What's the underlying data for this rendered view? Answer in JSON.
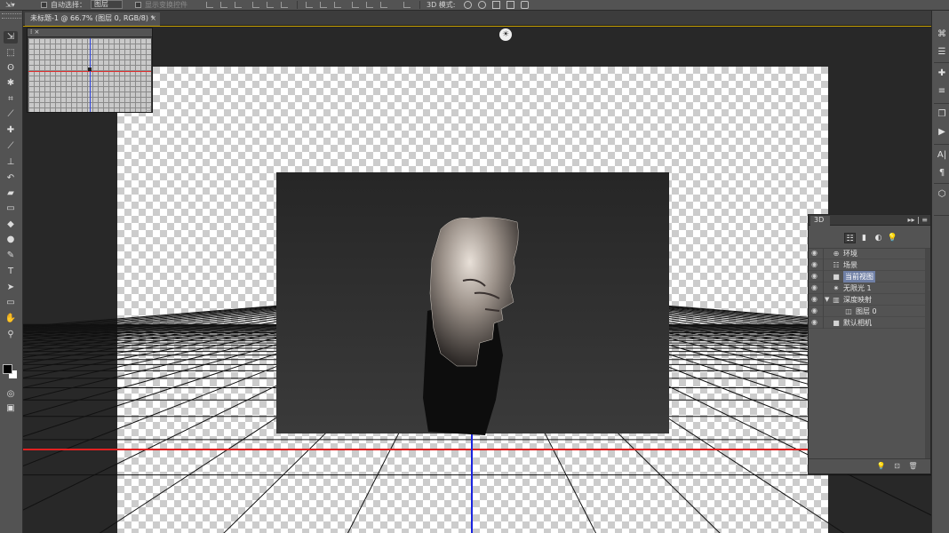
{
  "options_bar": {
    "auto_select_label": "自动选择：",
    "auto_select_value": "图层",
    "show_transform_label": "显示变换控件",
    "mode_3d_label": "3D 模式:"
  },
  "document": {
    "tab_title": "未标题-1 @ 66.7% (图层 0, RGB/8) *",
    "close_glyph": "×"
  },
  "toolbox": {
    "tools": [
      {
        "icon": "move-tool-icon",
        "glyph": "⇲"
      },
      {
        "icon": "marquee-tool-icon",
        "glyph": "⬚"
      },
      {
        "icon": "lasso-tool-icon",
        "glyph": "ʘ"
      },
      {
        "icon": "magic-wand-tool-icon",
        "glyph": "✱"
      },
      {
        "icon": "crop-tool-icon",
        "glyph": "⌗"
      },
      {
        "icon": "eyedropper-tool-icon",
        "glyph": "⟋"
      },
      {
        "icon": "healing-brush-tool-icon",
        "glyph": "✚"
      },
      {
        "icon": "brush-tool-icon",
        "glyph": "⟋"
      },
      {
        "icon": "clone-stamp-tool-icon",
        "glyph": "⊥"
      },
      {
        "icon": "history-brush-tool-icon",
        "glyph": "↶"
      },
      {
        "icon": "eraser-tool-icon",
        "glyph": "▰"
      },
      {
        "icon": "gradient-tool-icon",
        "glyph": "▭"
      },
      {
        "icon": "blur-tool-icon",
        "glyph": "◆"
      },
      {
        "icon": "dodge-tool-icon",
        "glyph": "●"
      },
      {
        "icon": "pen-tool-icon",
        "glyph": "✎"
      },
      {
        "icon": "type-tool-icon",
        "glyph": "T"
      },
      {
        "icon": "path-selection-tool-icon",
        "glyph": "➤"
      },
      {
        "icon": "rectangle-tool-icon",
        "glyph": "▭"
      },
      {
        "icon": "hand-tool-icon",
        "glyph": "✋"
      },
      {
        "icon": "zoom-tool-icon",
        "glyph": "⚲"
      }
    ],
    "foreground_color": "#000000",
    "background_color": "#ffffff"
  },
  "navigator": {
    "header_glyphs": "⁞ ×"
  },
  "view_widget_glyph": "☀",
  "panel_3d": {
    "tab_label": "3D",
    "menu_glyph": "▸▸ | ≡",
    "filter_icons": [
      "scene-filter-icon",
      "mesh-filter-icon",
      "material-filter-icon",
      "light-filter-icon"
    ],
    "filter_glyphs": [
      "☷",
      "▮",
      "◐",
      "💡"
    ],
    "tree": [
      {
        "label": "环境",
        "icon": "environment-icon",
        "glyph": "⊕",
        "indent": 0,
        "expanded": null,
        "selected": false
      },
      {
        "label": "场景",
        "icon": "scene-icon",
        "glyph": "☷",
        "indent": 0,
        "expanded": null,
        "selected": false
      },
      {
        "label": "当前视图",
        "icon": "camera-icon",
        "glyph": "■",
        "indent": 0,
        "expanded": null,
        "selected": true
      },
      {
        "label": "无限光 1",
        "icon": "infinite-light-icon",
        "glyph": "✷",
        "indent": 0,
        "expanded": null,
        "selected": false
      },
      {
        "label": "深度映射",
        "icon": "mesh-icon",
        "glyph": "▥",
        "indent": 0,
        "expanded": true,
        "selected": false
      },
      {
        "label": "图层 0",
        "icon": "material-icon",
        "glyph": "◫",
        "indent": 1,
        "expanded": null,
        "selected": false
      },
      {
        "label": "默认相机",
        "icon": "default-camera-icon",
        "glyph": "■",
        "indent": 0,
        "expanded": null,
        "selected": false
      }
    ],
    "footer_icons": [
      "add-light-icon",
      "render-icon",
      "delete-icon"
    ],
    "footer_glyphs": [
      "💡",
      "⊡",
      "🗑"
    ]
  },
  "right_dock": {
    "buttons": [
      {
        "icon": "history-icon",
        "glyph": "⌘"
      },
      {
        "icon": "adjustments-icon",
        "glyph": "☰"
      },
      {
        "icon": "styles-icon",
        "glyph": "✚"
      },
      {
        "icon": "properties-icon",
        "glyph": "≡"
      },
      {
        "icon": "layers-icon",
        "glyph": "❐"
      },
      {
        "icon": "play-actions-icon",
        "glyph": "▶"
      },
      {
        "icon": "character-icon",
        "glyph": "A|"
      },
      {
        "icon": "paragraph-icon",
        "glyph": "¶"
      },
      {
        "icon": "3d-panel-icon",
        "glyph": "⬡"
      }
    ]
  },
  "colors": {
    "accent_border": "#c8a000",
    "selection_highlight": "#6f7fa5",
    "x_axis": "#e02020",
    "z_axis": "#1a24e0"
  }
}
